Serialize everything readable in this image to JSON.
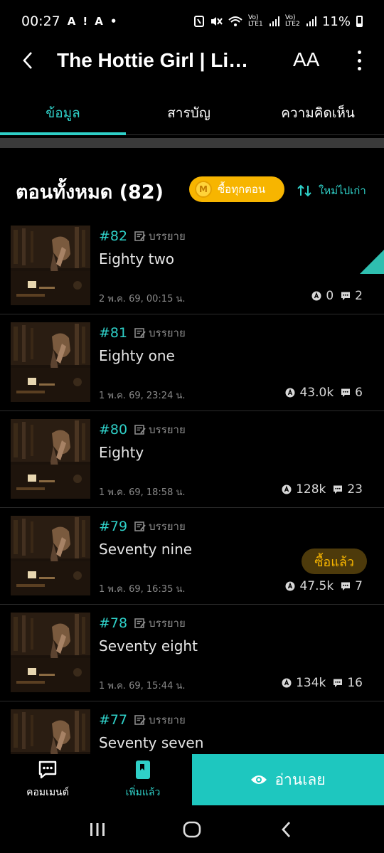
{
  "status_bar": {
    "time": "00:27",
    "left_icons": [
      "A",
      "!",
      "A",
      "•"
    ],
    "right_icons": [
      "nfc-icon",
      "mute-icon",
      "wifi-icon",
      "volte1-icon",
      "signal1-icon",
      "volte2-icon",
      "signal2-icon"
    ],
    "lte1": "Vo) LTE1",
    "lte2": "Vo) LTE2",
    "battery": "11%"
  },
  "app_bar": {
    "title": "The Hottie Girl | Lin...",
    "font_button": "AA"
  },
  "tabs": [
    {
      "label": "ข้อมูล",
      "active": true
    },
    {
      "label": "สารบัญ",
      "active": false
    },
    {
      "label": "ความคิดเห็น",
      "active": false
    }
  ],
  "episodes_header": {
    "title": "ตอนทั้งหมด (82)",
    "buy_all_label": "ซื้อทุกตอน",
    "coin_letter": "M",
    "sort_label": "ใหม่ไปเก่า"
  },
  "episodes": [
    {
      "number": "#82",
      "kind": "บรรยาย",
      "name": "Eighty two",
      "date": "2 พ.ค. 69, 00:15 น.",
      "views": "0",
      "comments": "2",
      "is_new": true,
      "bought": false
    },
    {
      "number": "#81",
      "kind": "บรรยาย",
      "name": "Eighty one",
      "date": "1 พ.ค. 69, 23:24 น.",
      "views": "43.0k",
      "comments": "6",
      "is_new": false,
      "bought": false
    },
    {
      "number": "#80",
      "kind": "บรรยาย",
      "name": "Eighty",
      "date": "1 พ.ค. 69, 18:58 น.",
      "views": "128k",
      "comments": "23",
      "is_new": false,
      "bought": false
    },
    {
      "number": "#79",
      "kind": "บรรยาย",
      "name": "Seventy nine",
      "date": "1 พ.ค. 69, 16:35 น.",
      "views": "47.5k",
      "comments": "7",
      "is_new": false,
      "bought": true
    },
    {
      "number": "#78",
      "kind": "บรรยาย",
      "name": "Seventy eight",
      "date": "1 พ.ค. 69, 15:44 น.",
      "views": "134k",
      "comments": "16",
      "is_new": false,
      "bought": false
    },
    {
      "number": "#77",
      "kind": "บรรยาย",
      "name": "Seventy seven",
      "date": "",
      "views": "",
      "comments": "",
      "is_new": false,
      "bought": false
    }
  ],
  "bought_label": "ซื้อแล้ว",
  "bottom_bar": {
    "comment_label": "คอมเมนต์",
    "added_label": "เพิ่มแล้ว",
    "read_label": "อ่านเลย"
  },
  "colors": {
    "accent": "#2fd0c8",
    "gold": "#f7b500",
    "read_button": "#1ec7bf",
    "background": "#000000"
  }
}
